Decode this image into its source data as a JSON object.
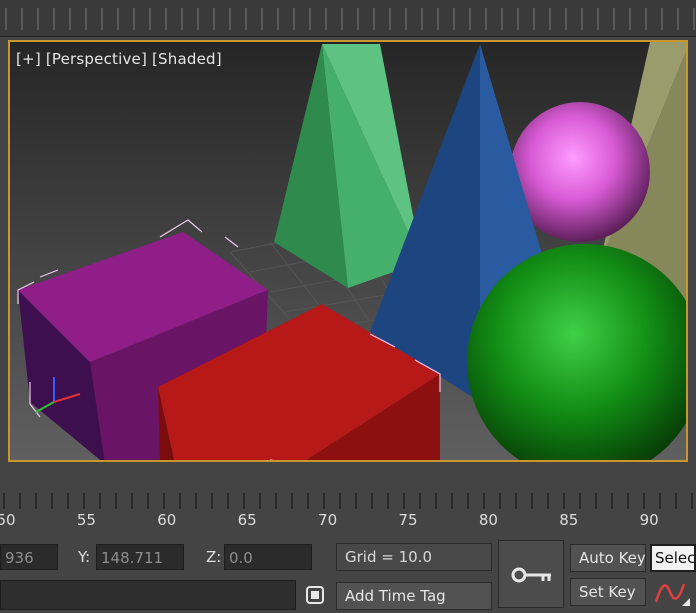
{
  "viewport": {
    "label_plus": "[+]",
    "label_view": "[Perspective]",
    "label_shading": "[Shaded]",
    "colors": {
      "border": "#c8962d",
      "background_top": "#2a2a2a",
      "background_bottom": "#5a5a5a"
    }
  },
  "timeline": {
    "ticks": [
      "50",
      "55",
      "60",
      "65",
      "70",
      "75",
      "80",
      "85",
      "90"
    ]
  },
  "status": {
    "x_value": "936",
    "y_label": "Y:",
    "y_value": "148.711",
    "z_label": "Z:",
    "z_value": "0.0",
    "grid_text": "Grid = 10.0",
    "add_time_tag": "Add Time Tag",
    "auto_key": "Auto Key",
    "set_key": "Set Key",
    "selected_label": "Selec",
    "key_icon": "key-icon",
    "curve_icon": "curve-editor-icon",
    "lock_icon": "selection-lock-icon"
  }
}
